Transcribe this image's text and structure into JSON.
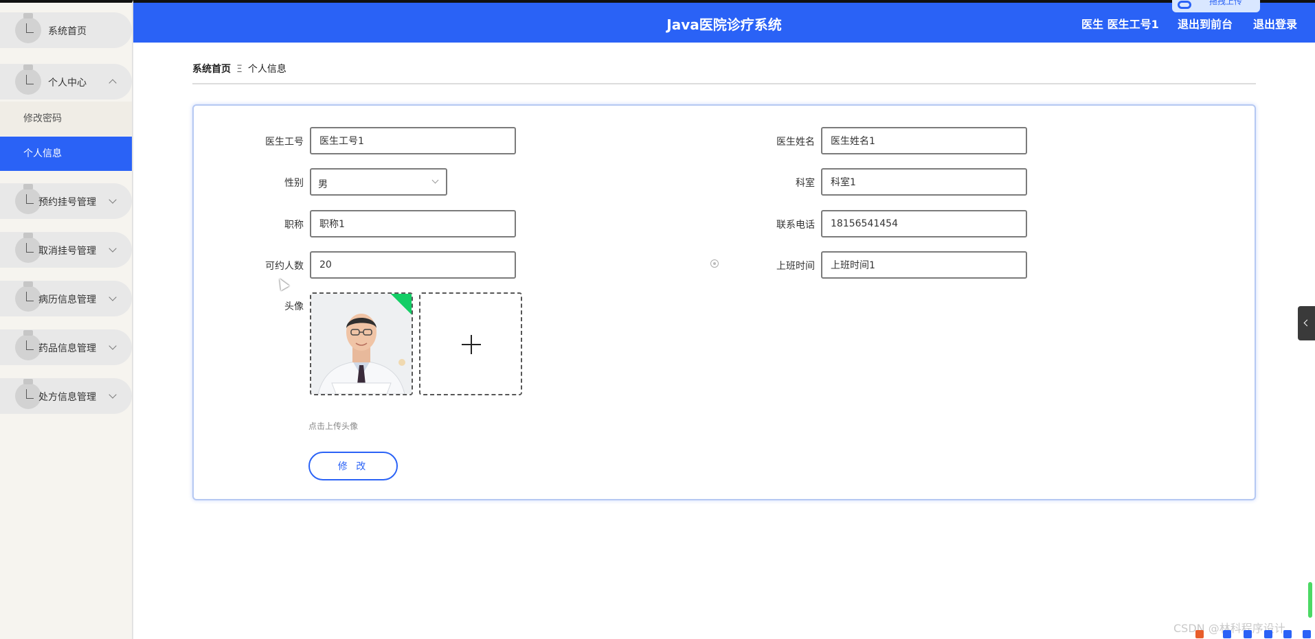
{
  "app": {
    "title": "Java医院诊疗系统"
  },
  "header": {
    "user_label": "医生 医生工号1",
    "back_to_front": "退出到前台",
    "logout": "退出登录",
    "upload_chip": "拖拽上传"
  },
  "sidebar": {
    "items": [
      {
        "label": "系统首页"
      },
      {
        "label": "个人中心",
        "expanded": true
      },
      {
        "label": "预约挂号管理"
      },
      {
        "label": "取消挂号管理"
      },
      {
        "label": "病历信息管理"
      },
      {
        "label": "药品信息管理"
      },
      {
        "label": "处方信息管理"
      }
    ],
    "subitems": [
      {
        "label": "修改密码"
      },
      {
        "label": "个人信息",
        "active": true
      }
    ],
    "active_color": "#2a62f6"
  },
  "breadcrumb": {
    "home": "系统首页",
    "separator": "Ξ",
    "current": "个人信息"
  },
  "form": {
    "doctor_id": {
      "label": "医生工号",
      "value": "医生工号1"
    },
    "doctor_name": {
      "label": "医生姓名",
      "value": "医生姓名1"
    },
    "gender": {
      "label": "性别",
      "value": "男"
    },
    "department": {
      "label": "科室",
      "value": "科室1"
    },
    "title": {
      "label": "职称",
      "value": "职称1"
    },
    "phone": {
      "label": "联系电话",
      "value": "18156541454"
    },
    "capacity": {
      "label": "可约人数",
      "value": "20"
    },
    "work_time": {
      "label": "上班时间",
      "value": "上班时间1"
    },
    "avatar": {
      "label": "头像",
      "hint": "点击上传头像"
    },
    "submit_label": "修 改"
  },
  "watermark": "CSDN @林科程序设计",
  "colors": {
    "primary": "#2a62f6",
    "success": "#13ce66",
    "sidebar_bg": "#f6f4ef"
  }
}
